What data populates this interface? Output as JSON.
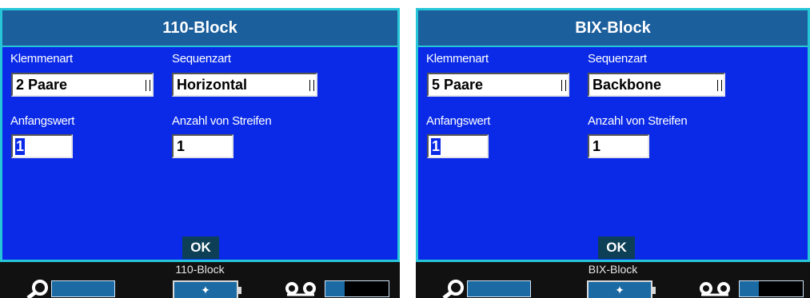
{
  "screens": [
    {
      "title": "110-Block",
      "klemmenart_label": "Klemmenart",
      "klemmenart_value": "2 Paare",
      "sequenzart_label": "Sequenzart",
      "sequenzart_value": "Horizontal",
      "anfangswert_label": "Anfangswert",
      "anfangswert_value": "1",
      "anzahl_label": "Anzahl von Streifen",
      "anzahl_value": "1",
      "ok_label": "OK",
      "status_label": "110-Block",
      "tape_remaining_fraction": 0.3
    },
    {
      "title": "BIX-Block",
      "klemmenart_label": "Klemmenart",
      "klemmenart_value": "5 Paare",
      "sequenzart_label": "Sequenzart",
      "sequenzart_value": "Backbone",
      "anfangswert_label": "Anfangswert",
      "anfangswert_value": "1",
      "anzahl_label": "Anzahl von Streifen",
      "anzahl_value": "1",
      "ok_label": "OK",
      "status_label": "BIX-Block",
      "tape_remaining_fraction": 0.3
    }
  ],
  "colors": {
    "dialog_bg": "#0a2ae8",
    "title_bg": "#1c5f9d",
    "border": "#26c6d8",
    "ok_bg": "#0d3f57"
  },
  "icons": [
    "magnifier-icon",
    "battery-charging-icon",
    "tape-cassette-icon"
  ]
}
